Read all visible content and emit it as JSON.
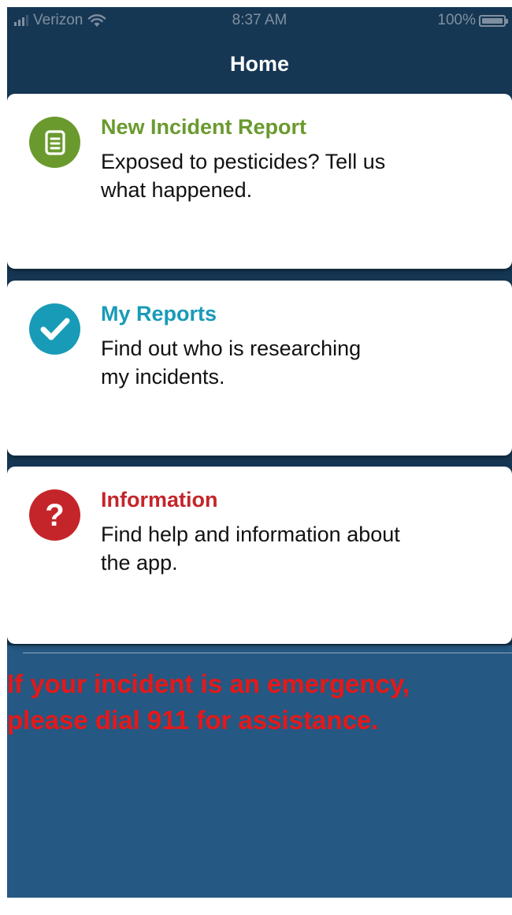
{
  "status_bar": {
    "carrier": "Verizon",
    "time": "8:37 AM",
    "battery": "100%",
    "battery_level": 1.0
  },
  "nav": {
    "title": "Home"
  },
  "cards": [
    {
      "title": "New Incident Report",
      "description_line1": "Exposed to pesticides? Tell us",
      "description_line2": "what happened.",
      "icon": "document-icon",
      "color": "#6a9a2e"
    },
    {
      "title": "My Reports",
      "description_line1": "Find out who is researching",
      "description_line2": "my incidents.",
      "icon": "checkmark-icon",
      "color": "#189bb7"
    },
    {
      "title": "Information",
      "description_line1": "Find help and information about",
      "description_line2": "the app.",
      "icon": "question-icon",
      "color": "#c4252a"
    }
  ],
  "emergency": {
    "line1": "If your incident is an emergency,",
    "line2": "please dial 911 for assistance.",
    "color": "#e61818"
  },
  "colors": {
    "nav_background": "#163753",
    "body_background": "#255882"
  }
}
